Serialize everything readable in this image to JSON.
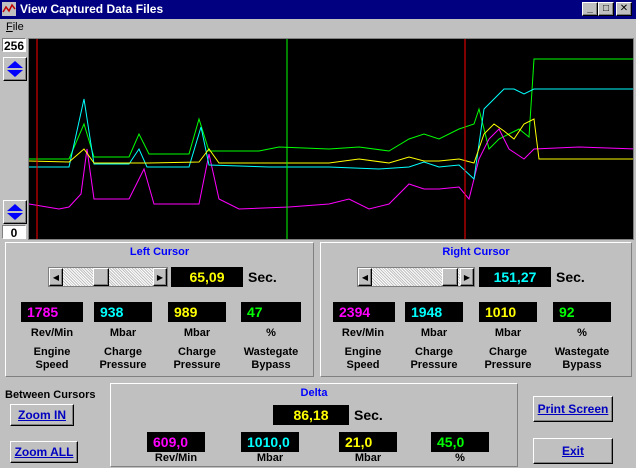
{
  "window": {
    "title": "View Captured Data Files",
    "minimize_glyph": "_",
    "maximize_glyph": "□",
    "close_glyph": "✕"
  },
  "menu": {
    "file": "File"
  },
  "scale": {
    "top": "256",
    "bottom": "0"
  },
  "left_cursor": {
    "title": "Left Cursor",
    "time": "65,09",
    "sec_label": "Sec.",
    "slider_position": 0.17,
    "readings": [
      {
        "value": "1785",
        "unit": "Rev/Min",
        "label_line1": "Engine",
        "label_line2": "Speed",
        "color": "#ff00ff"
      },
      {
        "value": "938",
        "unit": "Mbar",
        "label_line1": "Charge",
        "label_line2": "Pressure",
        "color": "#00ffff"
      },
      {
        "value": "989",
        "unit": "Mbar",
        "label_line1": "Charge",
        "label_line2": "Pressure",
        "color": "#ffff00"
      },
      {
        "value": "47",
        "unit": "%",
        "label_line1": "Wastegate",
        "label_line2": "Bypass",
        "color": "#00ff00"
      }
    ]
  },
  "right_cursor": {
    "title": "Right Cursor",
    "time": "151,27",
    "sec_label": "Sec.",
    "slider_position": 0.83,
    "time_color": "#00ffff",
    "readings": [
      {
        "value": "2394",
        "unit": "Rev/Min",
        "label_line1": "Engine",
        "label_line2": "Speed",
        "color": "#ff00ff"
      },
      {
        "value": "1948",
        "unit": "Mbar",
        "label_line1": "Charge",
        "label_line2": "Pressure",
        "color": "#00ffff"
      },
      {
        "value": "1010",
        "unit": "Mbar",
        "label_line1": "Charge",
        "label_line2": "Pressure",
        "color": "#ffff00"
      },
      {
        "value": "92",
        "unit": "%",
        "label_line1": "Wastegate",
        "label_line2": "Bypass",
        "color": "#00ff00"
      }
    ]
  },
  "between": {
    "label": "Between Cursors",
    "zoom_in": "Zoom IN",
    "zoom_all": "Zoom ALL"
  },
  "delta": {
    "title": "Delta",
    "time": "86,18",
    "sec_label": "Sec.",
    "readings": [
      {
        "value": "609,0",
        "unit": "Rev/Min",
        "color": "#ff00ff"
      },
      {
        "value": "1010,0",
        "unit": "Mbar",
        "color": "#00ffff"
      },
      {
        "value": "21,0",
        "unit": "Mbar",
        "color": "#ffff00"
      },
      {
        "value": "45,0",
        "unit": "%",
        "color": "#00ff00"
      }
    ]
  },
  "buttons": {
    "print_screen": "Print Screen",
    "exit": "Exit"
  },
  "colors": {
    "title_bar": "#000080",
    "panel_title": "#0000ff",
    "left_cursor_line": "#ff0000",
    "middle_cursor_line": "#00ff00",
    "right_cursor_line": "#ff0000",
    "time_readout": "#ffff00"
  }
}
